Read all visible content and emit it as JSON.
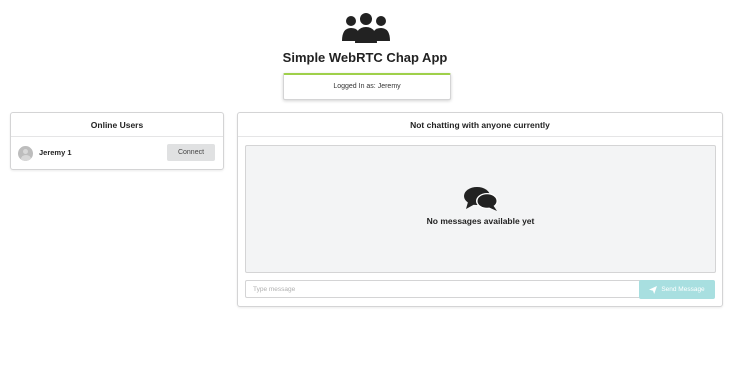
{
  "header": {
    "icon": "users-group-icon",
    "title": "Simple WebRTC Chap App",
    "logged_in_text": "Logged In as: Jeremy"
  },
  "users_panel": {
    "title": "Online Users",
    "users": [
      {
        "name": "Jeremy 1",
        "action_label": "Connect"
      }
    ]
  },
  "chat_panel": {
    "title": "Not chatting with anyone currently",
    "empty_icon": "comments-icon",
    "empty_text": "No messages available yet",
    "input_value": "",
    "input_placeholder": "Type message",
    "send_label": "Send Message",
    "send_icon": "paper-plane-icon"
  },
  "colors": {
    "login_accent": "#9fd04a",
    "send_button": "#a8dfe0",
    "connect_button": "#e0e1e2",
    "messages_background": "#f3f4f5"
  }
}
